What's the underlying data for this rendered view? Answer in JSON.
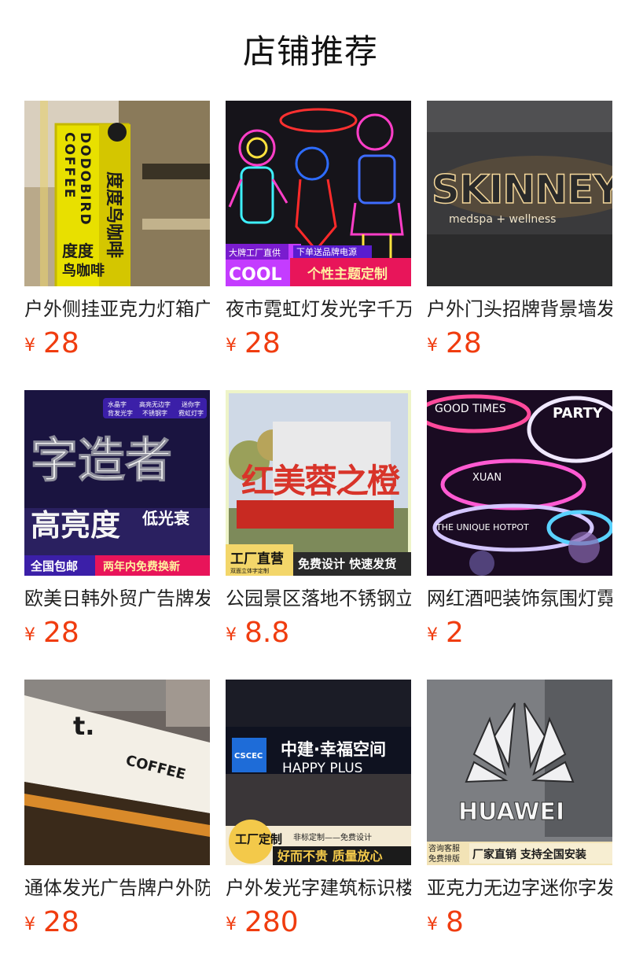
{
  "page": {
    "title": "店铺推荐"
  },
  "products": [
    {
      "title": "户外侧挂亚克力灯箱广告牌",
      "currency": "¥",
      "price": "28",
      "image_text": [
        "DODOBIRD",
        "COFFEE",
        "度度鸟咖啡",
        "度度",
        "鸟咖啡"
      ]
    },
    {
      "title": "夜市霓虹灯发光字千万个性",
      "currency": "¥",
      "price": "28",
      "image_text": [
        "大牌工厂直供",
        "COOL",
        "下单送品牌电源",
        "个性主题定制"
      ]
    },
    {
      "title": "户外门头招牌背景墙发光字",
      "currency": "¥",
      "price": "28",
      "image_text": [
        "SKINNEY",
        "medspa + wellness"
      ]
    },
    {
      "title": "欧美日韩外贸广告牌发光字",
      "currency": "¥",
      "price": "28",
      "image_text": [
        "水晶字",
        "高亮无边字",
        "迷你字",
        "背发光字",
        "不锈钢字",
        "霓虹灯字",
        "字造者",
        "高亮度",
        "低光衰",
        "全国包邮",
        "两年内免费换新"
      ]
    },
    {
      "title": "公园景区落地不锈钢立体字",
      "currency": "¥",
      "price": "8.8",
      "image_text": [
        "红美蓉之橙",
        "工厂直营",
        "双面立体字定制",
        "免费设计 快速发货"
      ]
    },
    {
      "title": "网红酒吧装饰氛围灯霓虹灯",
      "currency": "¥",
      "price": "2",
      "image_text": [
        "GOOD TIMES",
        "PARTY",
        "XUAN",
        "THE UNIQUE HOTPOT"
      ]
    },
    {
      "title": "通体发光广告牌户外防水灯",
      "currency": "¥",
      "price": "28",
      "image_text": [
        "t.",
        "COFFEE"
      ]
    },
    {
      "title": "户外发光字建筑标识楼顶字",
      "currency": "¥",
      "price": "280",
      "image_text": [
        "中建·幸福空间",
        "HAPPY PLUS",
        "CSCEC",
        "工厂定制",
        "非标定制——免费设计",
        "好而不贵 质量放心"
      ]
    },
    {
      "title": "亚克力无边字迷你字发光字",
      "currency": "¥",
      "price": "8",
      "image_text": [
        "HUAWEI",
        "咨询客服",
        "免费排版",
        "厂家直销 支持全国安装"
      ]
    }
  ]
}
